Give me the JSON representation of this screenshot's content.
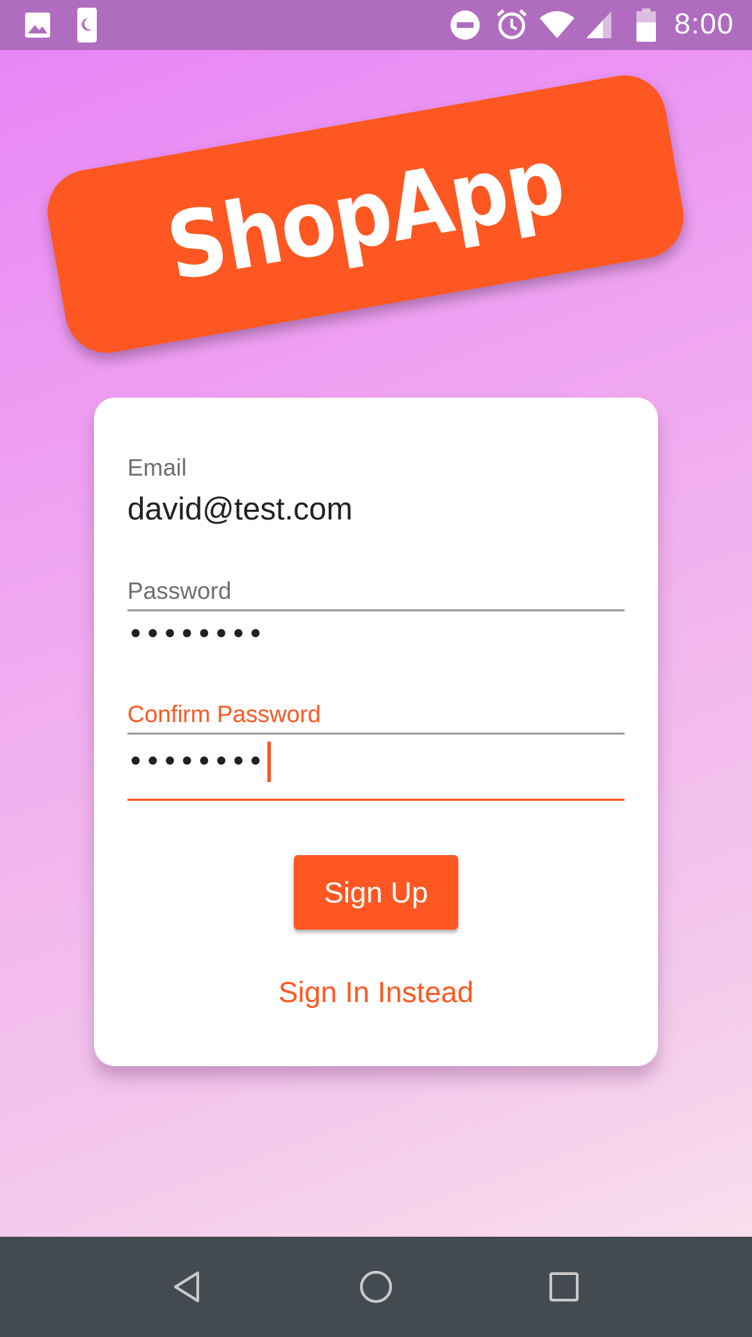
{
  "status_bar": {
    "time": "8:00",
    "left_icons": [
      "gallery-icon",
      "moon-icon"
    ],
    "right_icons": [
      "do-not-disturb-icon",
      "alarm-icon",
      "wifi-icon",
      "signal-icon",
      "battery-icon"
    ]
  },
  "logo": {
    "text": "ShopApp",
    "color": "#ff5722"
  },
  "form": {
    "email": {
      "label": "Email",
      "value": "david@test.com"
    },
    "password": {
      "label": "Password",
      "masked_value": "••••••••"
    },
    "confirm_password": {
      "label": "Confirm Password",
      "masked_value": "••••••••"
    }
  },
  "buttons": {
    "sign_up": "Sign Up",
    "switch_mode": "Sign In Instead"
  },
  "nav_bar": {
    "buttons": [
      "back-icon",
      "home-icon",
      "recents-icon"
    ]
  },
  "colors": {
    "accent": "#ff5722",
    "status_bar": "#b06cbf",
    "nav_bar": "#434a50"
  }
}
